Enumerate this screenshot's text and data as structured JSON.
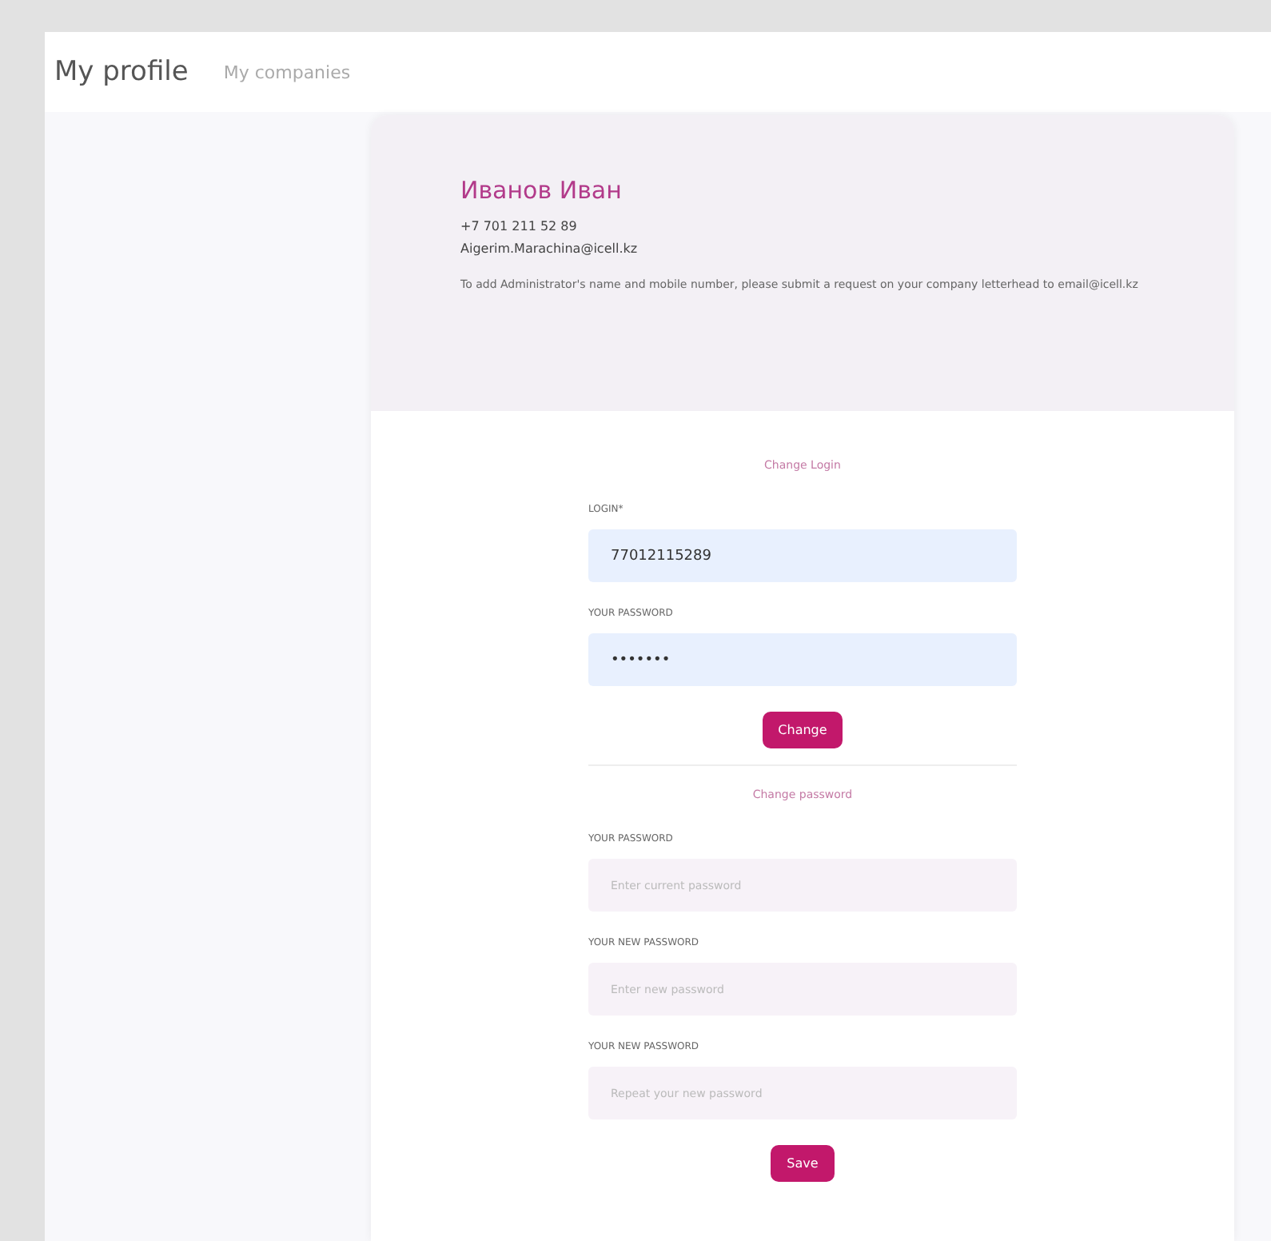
{
  "header": {
    "tabs": [
      {
        "label": "My profile",
        "selected": true
      },
      {
        "label": "My companies",
        "selected": false
      }
    ]
  },
  "profile": {
    "name": "Иванов Иван",
    "phone": "+7 701 211 52 89",
    "email": "Aigerim.Marachina@icell.kz",
    "note": "To add Administrator's name and mobile number, please submit a request on your company letterhead to email@icell.kz"
  },
  "login_form": {
    "title": "Change Login",
    "fields": [
      {
        "label": "LOGIN*",
        "value": "77012115289"
      },
      {
        "label": "YOUR PASSWORD",
        "value": "•••••••"
      }
    ],
    "button": "Change"
  },
  "password_form": {
    "title": "Change password",
    "fields": [
      {
        "label": "YOUR PASSWORD",
        "placeholder": "Enter current password"
      },
      {
        "label": "YOUR NEW PASSWORD",
        "placeholder": "Enter new password"
      },
      {
        "label": "YOUR NEW PASSWORD",
        "placeholder": "Repeat your new password"
      }
    ],
    "button": "Save"
  }
}
